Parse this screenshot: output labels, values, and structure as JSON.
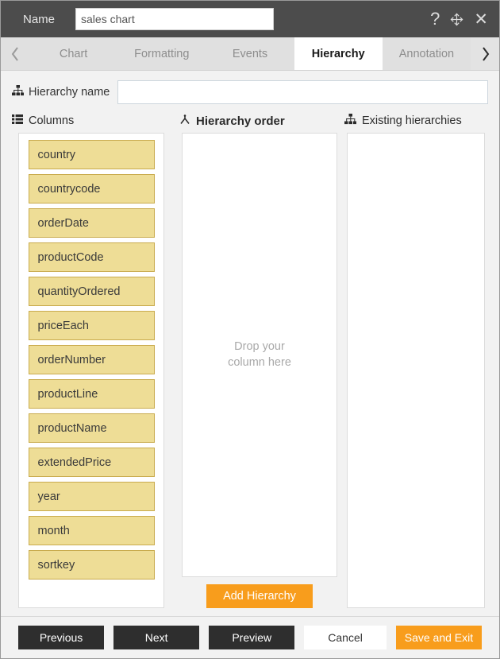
{
  "titlebar": {
    "name_label": "Name",
    "name_value": "sales chart",
    "name_placeholder": "",
    "help_icon": "question-mark-icon",
    "move_icon": "move-arrows-icon",
    "close_icon": "close-icon"
  },
  "tabbar": {
    "prev_arrow": "chevron-left-icon",
    "next_arrow": "chevron-right-icon",
    "tabs": [
      {
        "label": "Chart",
        "active": false
      },
      {
        "label": "Formatting",
        "active": false
      },
      {
        "label": "Events",
        "active": false
      },
      {
        "label": "Hierarchy",
        "active": true
      },
      {
        "label": "Annotation",
        "active": false
      }
    ]
  },
  "hierarchy_name": {
    "icon": "sitemap-icon",
    "label": "Hierarchy name",
    "value": "",
    "placeholder": ""
  },
  "sections": {
    "columns": {
      "icon": "list-icon",
      "title": "Columns"
    },
    "order": {
      "icon": "tree-fork-icon",
      "title": "Hierarchy order"
    },
    "existing": {
      "icon": "sitemap-icon",
      "title": "Existing hierarchies"
    }
  },
  "columns": [
    "country",
    "countrycode",
    "orderDate",
    "productCode",
    "quantityOrdered",
    "priceEach",
    "orderNumber",
    "productLine",
    "productName",
    "extendedPrice",
    "year",
    "month",
    "sortkey"
  ],
  "drop_zone": {
    "placeholder": "Drop your\ncolumn here",
    "items": []
  },
  "add_hierarchy_button": "Add Hierarchy",
  "existing_hierarchies": [],
  "footer": {
    "previous": "Previous",
    "next": "Next",
    "preview": "Preview",
    "cancel": "Cancel",
    "save_and_exit": "Save and Exit"
  },
  "colors": {
    "titlebar_bg": "#4c4c4c",
    "accent": "#f89d1c",
    "chip_bg": "#eedd96",
    "chip_border": "#c9ab4e",
    "dark_button": "#2e2e2e"
  }
}
